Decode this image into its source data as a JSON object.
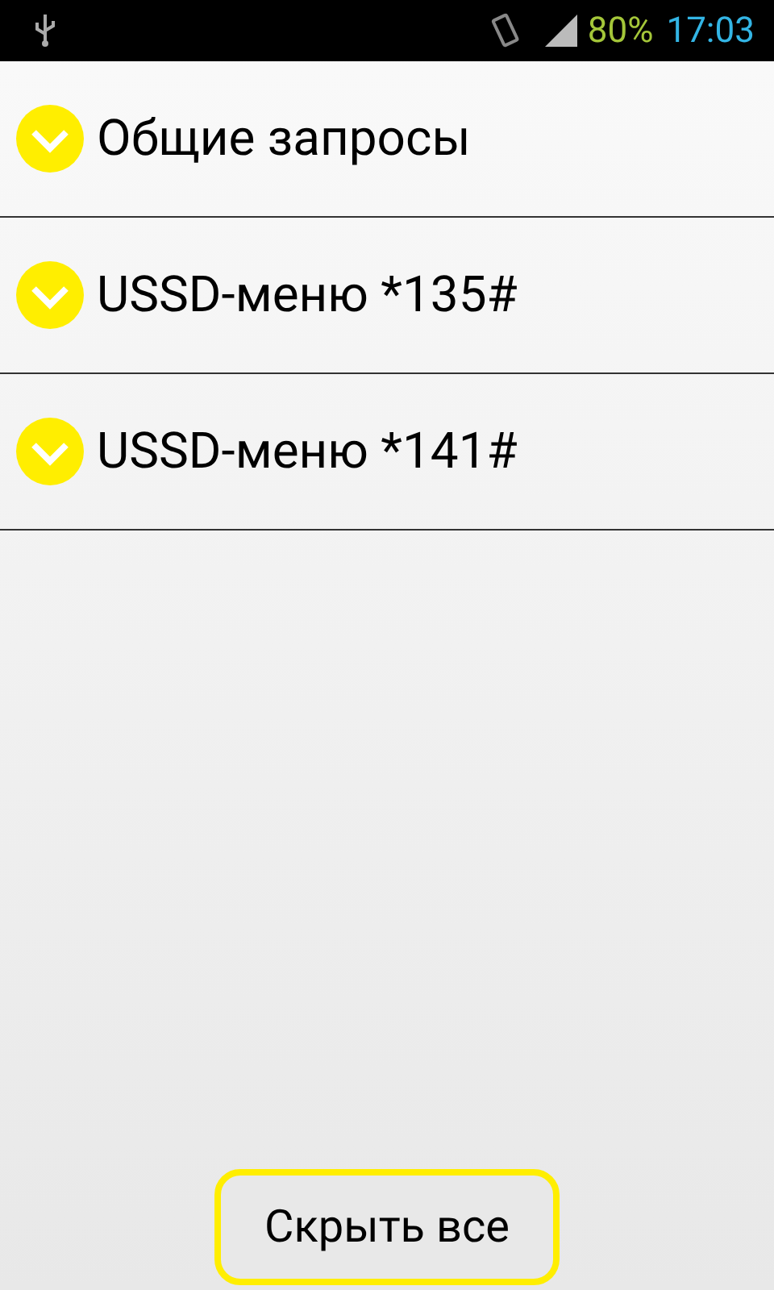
{
  "status_bar": {
    "battery": "80%",
    "time": "17:03"
  },
  "groups": [
    {
      "title": "Общие запросы",
      "expanded": false
    },
    {
      "title": "USSD-меню *135#",
      "expanded": false
    },
    {
      "title": "USSD-меню *141#",
      "expanded": false
    }
  ],
  "hide_all_button": "Скрыть все"
}
